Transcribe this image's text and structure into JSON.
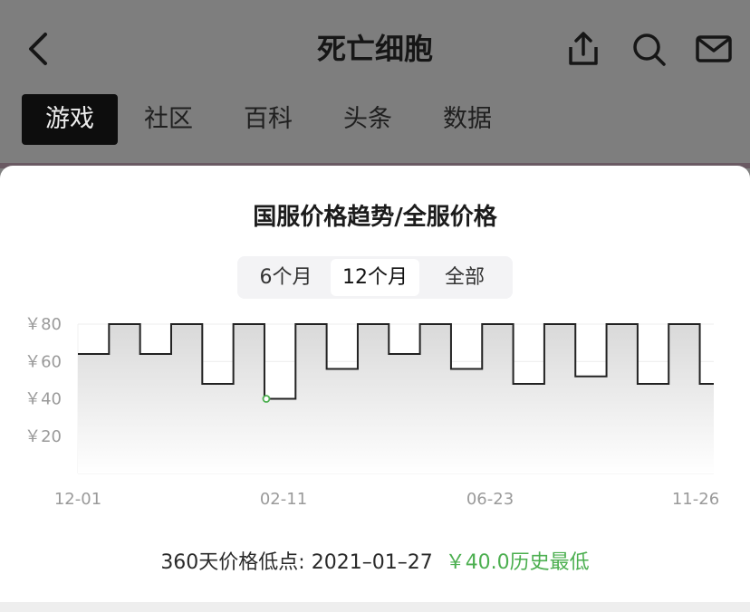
{
  "header": {
    "title": "死亡细胞",
    "tabs": [
      {
        "label": "游戏",
        "active": true
      },
      {
        "label": "社区",
        "active": false
      },
      {
        "label": "百科",
        "active": false
      },
      {
        "label": "头条",
        "active": false
      },
      {
        "label": "数据",
        "active": false
      }
    ],
    "icons": [
      "back-icon",
      "share-icon",
      "search-icon",
      "mail-icon"
    ]
  },
  "panel": {
    "title": "国服价格趋势/全服价格",
    "range_options": [
      "6个月",
      "12个月",
      "全部"
    ],
    "selected_range": "12个月",
    "low_text": "360天价格低点: 2021–01–27",
    "low_value": "￥40.0历史最低"
  },
  "chart_data": {
    "type": "line",
    "step": true,
    "y_ticks": [
      "￥80",
      "￥60",
      "￥40",
      "￥20"
    ],
    "x_ticks": [
      "12-01",
      "02-11",
      "06-23",
      "11-26"
    ],
    "ylim": [
      0,
      80
    ],
    "values": [
      64,
      80,
      64,
      80,
      48,
      80,
      40,
      80,
      56,
      80,
      64,
      80,
      56,
      80,
      48,
      80,
      52,
      80,
      48,
      80,
      48
    ],
    "min_marker_index": 6,
    "colors": {
      "line": "#222222",
      "fill_top": "#d7d7d7",
      "marker": "#4caf50",
      "grid": "#ececec"
    }
  }
}
